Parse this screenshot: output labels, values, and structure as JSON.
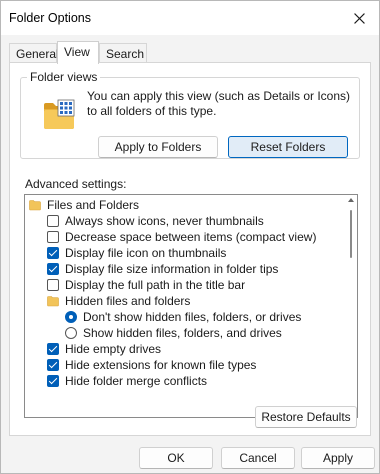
{
  "window": {
    "title": "Folder Options"
  },
  "tabs": [
    {
      "label": "General"
    },
    {
      "label": "View"
    },
    {
      "label": "Search"
    }
  ],
  "folder_views": {
    "legend": "Folder views",
    "description": "You can apply this view (such as Details or Icons) to all folders of this type.",
    "apply_button": "Apply to Folders",
    "reset_button": "Reset Folders"
  },
  "advanced": {
    "label": "Advanced settings:",
    "items": [
      {
        "type": "folder",
        "label": "Files and Folders",
        "checked": null
      },
      {
        "type": "checkbox",
        "label": "Always show icons, never thumbnails",
        "checked": false
      },
      {
        "type": "checkbox",
        "label": "Decrease space between items (compact view)",
        "checked": false
      },
      {
        "type": "checkbox",
        "label": "Display file icon on thumbnails",
        "checked": true
      },
      {
        "type": "checkbox",
        "label": "Display file size information in folder tips",
        "checked": true
      },
      {
        "type": "checkbox",
        "label": "Display the full path in the title bar",
        "checked": false
      },
      {
        "type": "folder",
        "label": "Hidden files and folders",
        "checked": null
      },
      {
        "type": "radio",
        "label": "Don't show hidden files, folders, or drives",
        "checked": true
      },
      {
        "type": "radio",
        "label": "Show hidden files, folders, and drives",
        "checked": false
      },
      {
        "type": "checkbox",
        "label": "Hide empty drives",
        "checked": true
      },
      {
        "type": "checkbox",
        "label": "Hide extensions for known file types",
        "checked": true
      },
      {
        "type": "checkbox",
        "label": "Hide folder merge conflicts",
        "checked": true
      }
    ]
  },
  "restore_button": "Restore Defaults",
  "footer": {
    "ok": "OK",
    "cancel": "Cancel",
    "apply": "Apply"
  },
  "colors": {
    "accent": "#005fb8",
    "folder": "#f2c45a"
  }
}
